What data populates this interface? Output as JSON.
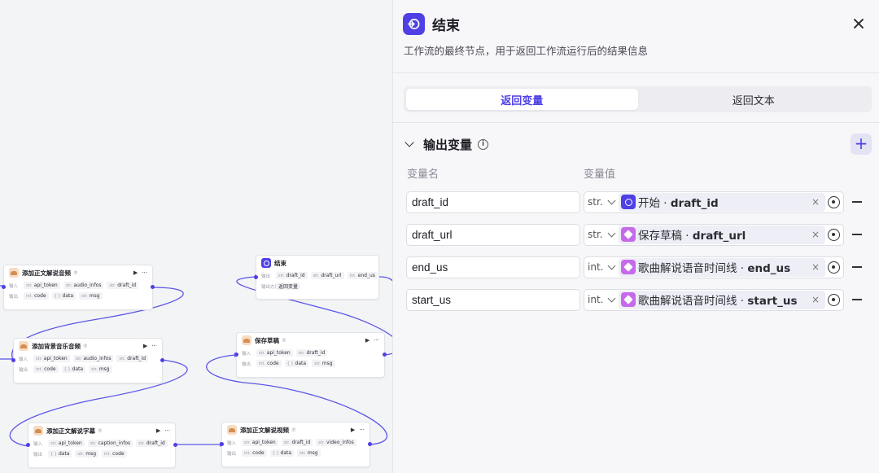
{
  "canvas": {
    "nodes": [
      {
        "id": "n1",
        "title": "添加正文解说音频",
        "badge": "℗",
        "kind": "plugin",
        "run": "▶",
        "more": "···",
        "inputs_label": "输入",
        "outputs_label": "输出",
        "inputs": [
          {
            "type": "str.",
            "name": "api_token"
          },
          {
            "type": "str.",
            "name": "audio_infos"
          },
          {
            "type": "str.",
            "name": "draft_id"
          }
        ],
        "outputs": [
          {
            "type": "int.",
            "name": "code"
          },
          {
            "type": "{ }",
            "name": "data"
          },
          {
            "type": "str.",
            "name": "msg"
          }
        ]
      },
      {
        "id": "n2",
        "title": "添加背景音乐音频",
        "badge": "℗",
        "kind": "plugin",
        "run": "▶",
        "more": "···",
        "inputs_label": "输入",
        "outputs_label": "输出",
        "inputs": [
          {
            "type": "str.",
            "name": "api_token"
          },
          {
            "type": "str.",
            "name": "audio_infos"
          },
          {
            "type": "str.",
            "name": "draft_id"
          }
        ],
        "outputs": [
          {
            "type": "int.",
            "name": "code"
          },
          {
            "type": "{ }",
            "name": "data"
          },
          {
            "type": "str.",
            "name": "msg"
          }
        ]
      },
      {
        "id": "n3",
        "title": "添加正文解说字幕",
        "badge": "℗",
        "kind": "plugin",
        "run": "▶",
        "more": "···",
        "inputs_label": "输入",
        "outputs_label": "输出",
        "inputs": [
          {
            "type": "str.",
            "name": "api_token"
          },
          {
            "type": "str.",
            "name": "caption_infos"
          },
          {
            "type": "str.",
            "name": "draft_id"
          }
        ],
        "outputs": [
          {
            "type": "{ }",
            "name": "data"
          },
          {
            "type": "str.",
            "name": "msg"
          },
          {
            "type": "int.",
            "name": "code"
          }
        ]
      },
      {
        "id": "n4",
        "title": "结束",
        "badge": "",
        "kind": "end",
        "run": "",
        "more": "",
        "inputs_label": "输出",
        "outputs_label": "输出方案",
        "inputs": [
          {
            "type": "str.",
            "name": "draft_id"
          },
          {
            "type": "str.",
            "name": "draft_url"
          },
          {
            "type": "int.",
            "name": "end_us"
          }
        ],
        "outputs": [
          {
            "type": "",
            "name": "返回变量"
          }
        ]
      },
      {
        "id": "n5",
        "title": "保存草稿",
        "badge": "℗",
        "kind": "plugin",
        "run": "▶",
        "more": "···",
        "inputs_label": "输入",
        "outputs_label": "输出",
        "inputs": [
          {
            "type": "str.",
            "name": "api_token"
          },
          {
            "type": "str.",
            "name": "draft_id"
          }
        ],
        "outputs": [
          {
            "type": "int.",
            "name": "code"
          },
          {
            "type": "{ }",
            "name": "data"
          },
          {
            "type": "str.",
            "name": "msg"
          }
        ]
      },
      {
        "id": "n6",
        "title": "添加正文解说视频",
        "badge": "℗",
        "kind": "plugin",
        "run": "▶",
        "more": "···",
        "inputs_label": "输入",
        "outputs_label": "输出",
        "inputs": [
          {
            "type": "str.",
            "name": "api_token"
          },
          {
            "type": "str.",
            "name": "draft_id"
          },
          {
            "type": "str.",
            "name": "video_infos"
          }
        ],
        "outputs": [
          {
            "type": "int.",
            "name": "code"
          },
          {
            "type": "{ }",
            "name": "data"
          },
          {
            "type": "str.",
            "name": "msg"
          }
        ]
      }
    ]
  },
  "panel": {
    "title": "结束",
    "description": "工作流的最终节点，用于返回工作流运行后的结果信息",
    "tabs": [
      {
        "label": "返回变量",
        "active": true
      },
      {
        "label": "返回文本",
        "active": false
      }
    ],
    "section_title": "输出变量",
    "info_glyph": "i",
    "add_glyph": "+",
    "col_name": "变量名",
    "col_value": "变量值",
    "clear_glyph": "×",
    "variables": [
      {
        "name": "draft_id",
        "type": "str.",
        "source_icon": "start",
        "source": "开始",
        "sep": " · ",
        "field": "draft_id"
      },
      {
        "name": "draft_url",
        "type": "str.",
        "source_icon": "cube",
        "source": "保存草稿",
        "sep": " · ",
        "field": "draft_url"
      },
      {
        "name": "end_us",
        "type": "int.",
        "source_icon": "cube",
        "source": "歌曲解说语音时间线",
        "sep": " · ",
        "field": "end_us"
      },
      {
        "name": "start_us",
        "type": "int.",
        "source_icon": "cube",
        "source": "歌曲解说语音时间线",
        "sep": " · ",
        "field": "start_us"
      }
    ]
  },
  "colors": {
    "accent": "#4e40e5",
    "wire": "#5b57e6",
    "plugin_ref": "#c56bea"
  }
}
